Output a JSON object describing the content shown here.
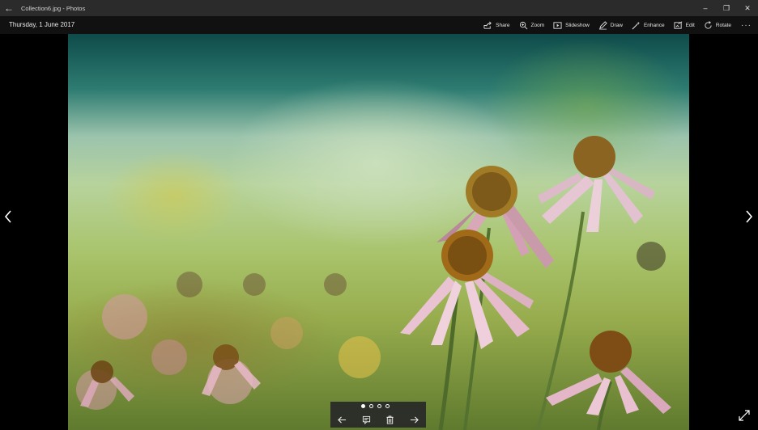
{
  "window": {
    "title": "Collection6.jpg - Photos"
  },
  "command_bar": {
    "date": "Thursday, 1 June 2017",
    "actions": [
      {
        "label": "Share",
        "icon": "share-icon"
      },
      {
        "label": "Zoom",
        "icon": "zoom-icon"
      },
      {
        "label": "Slideshow",
        "icon": "slideshow-icon"
      },
      {
        "label": "Draw",
        "icon": "draw-icon"
      },
      {
        "label": "Enhance",
        "icon": "enhance-icon"
      },
      {
        "label": "Edit",
        "icon": "edit-icon"
      },
      {
        "label": "Rotate",
        "icon": "rotate-icon"
      }
    ],
    "more": "···"
  },
  "filmstrip": {
    "page_count": 4,
    "active_index": 0
  },
  "colors": {
    "titlebar": "#2b2b2b",
    "commandbar": "#111111",
    "background": "#000000"
  }
}
